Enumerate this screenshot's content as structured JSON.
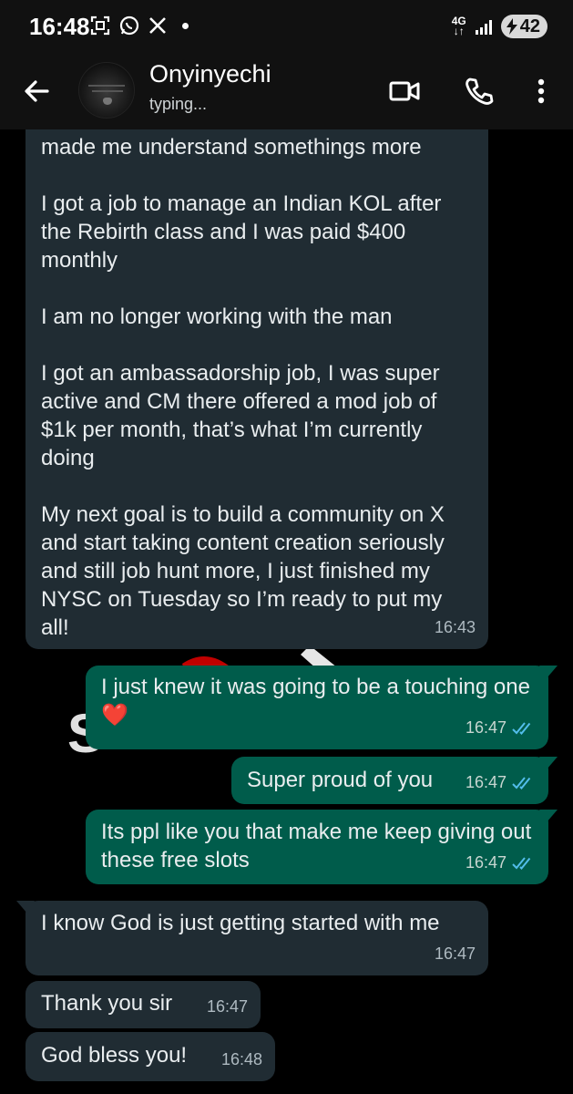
{
  "status_bar": {
    "time": "16:48",
    "network": "4G",
    "battery": "42"
  },
  "header": {
    "contact_name": "Onyinyechi",
    "status": "typing..."
  },
  "messages": [
    {
      "direction": "incoming",
      "text": "made me understand somethings more\n\nI got a job to manage an Indian KOL after the Rebirth class and I was paid $400 monthly\n\nI am no longer working with the man\n\nI got an ambassadorship job, I was super active and CM there offered a mod job of $1k per month, that’s what I’m currently doing\n\nMy next goal is to build a community on X and start taking content creation seriously and still job hunt more, I just finished my NYSC on Tuesday so I’m ready to put my all!",
      "time": "16:43"
    },
    {
      "direction": "outgoing",
      "text": "I just knew it was going to be a touching one❤️",
      "time": "16:47",
      "read": true
    },
    {
      "direction": "outgoing",
      "text": "Super proud of you",
      "time": "16:47",
      "read": true
    },
    {
      "direction": "outgoing",
      "text": "Its ppl like you that make me keep giving out these free slots",
      "time": "16:47",
      "read": true
    },
    {
      "direction": "incoming",
      "text": "I know God is just getting started with me",
      "time": "16:47"
    },
    {
      "direction": "incoming",
      "text": "Thank you sir",
      "time": "16:47"
    },
    {
      "direction": "incoming",
      "text": "God bless you!",
      "time": "16:48"
    }
  ],
  "colors": {
    "incoming_bubble": "#202c33",
    "outgoing_bubble": "#005c4b",
    "read_tick": "#53bdeb"
  }
}
